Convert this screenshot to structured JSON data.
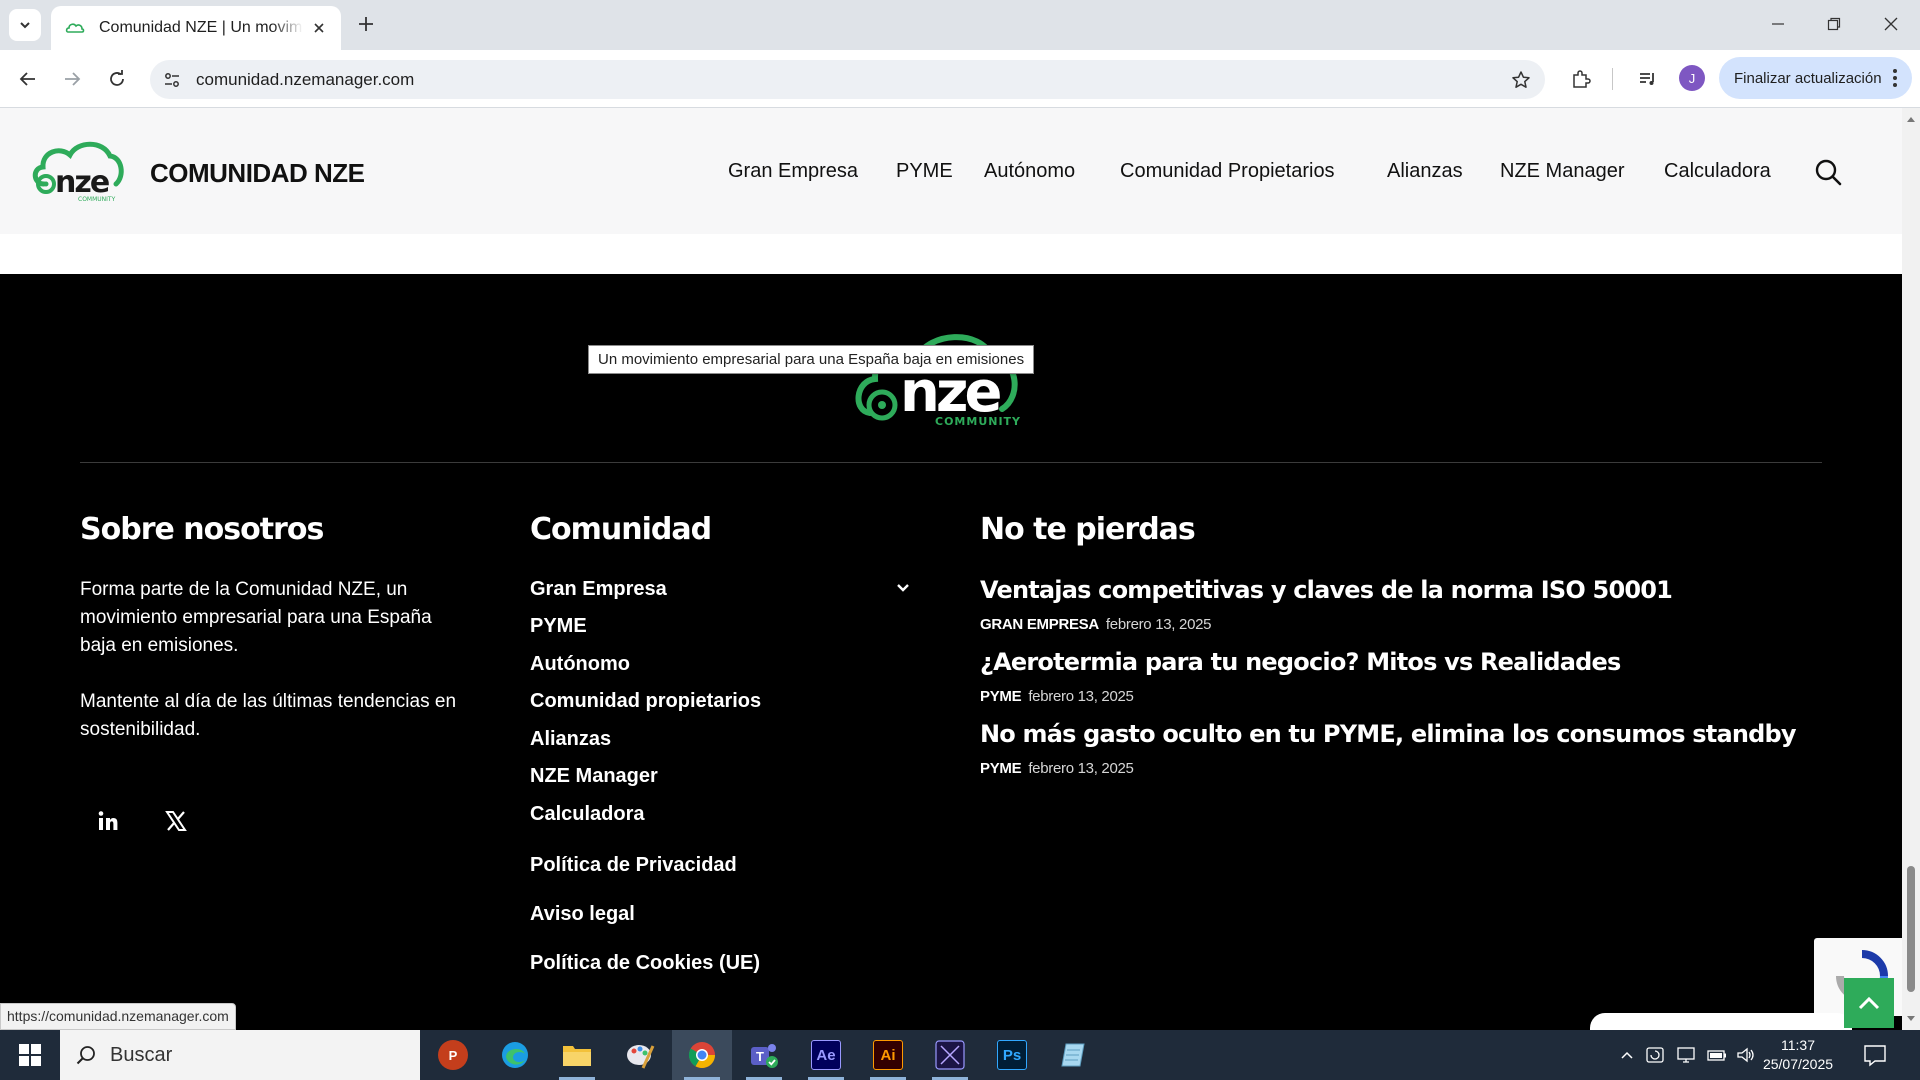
{
  "browser": {
    "tab_title": "Comunidad NZE | Un movimiento empresarial para una España baja en emisiones",
    "url": "comunidad.nzemanager.com",
    "update_button": "Finalizar actualización",
    "profile_initial": "J",
    "status_url": "https://comunidad.nzemanager.com"
  },
  "header": {
    "brand": "COMUNIDAD NZE",
    "nav": [
      "Gran Empresa",
      "PYME",
      "Autónomo",
      "Comunidad Propietarios",
      "Alianzas",
      "NZE Manager",
      "Calculadora"
    ]
  },
  "tooltip": "Un movimiento empresarial para una España baja en emisiones",
  "footer": {
    "logo_text": "nze",
    "logo_sub": "COMMUNITY",
    "about": {
      "title": "Sobre nosotros",
      "p1": "Forma parte de la Comunidad NZE, un movimiento empresarial para una España baja en emisiones.",
      "p2": "Mantente al día de las últimas tendencias en sostenibilidad.",
      "social": [
        "linkedin-icon",
        "x-icon"
      ]
    },
    "community": {
      "title": "Comunidad",
      "links": [
        "Gran Empresa",
        "PYME",
        "Autónomo",
        "Comunidad propietarios",
        "Alianzas",
        "NZE Manager",
        "Calculadora"
      ],
      "legal": [
        "Política de Privacidad",
        "Aviso legal",
        "Política de Cookies (UE)"
      ]
    },
    "dont_miss": {
      "title": "No te pierdas",
      "posts": [
        {
          "title": "Ventajas competitivas y claves de la norma ISO 50001",
          "category": "GRAN EMPRESA",
          "date": "febrero 13, 2025"
        },
        {
          "title": "¿Aerotermia para tu negocio? Mitos vs Realidades",
          "category": "PYME",
          "date": "febrero 13, 2025"
        },
        {
          "title": "No más gasto oculto en tu PYME, elimina los consumos standby",
          "category": "PYME",
          "date": "febrero 13, 2025"
        }
      ]
    }
  },
  "taskbar": {
    "search_label": "Buscar",
    "time": "11:37",
    "date": "25/07/2025",
    "apps": [
      "powerpoint-icon",
      "edge-icon",
      "file-explorer-icon",
      "paint-icon",
      "chrome-icon",
      "teams-icon",
      "after-effects-icon",
      "illustrator-icon",
      "premiere-icon",
      "photoshop-icon",
      "notepad-icon"
    ],
    "app_labels": {
      "powerpoint": "P",
      "after_effects": "Ae",
      "illustrator": "Ai",
      "photoshop": "Ps"
    }
  },
  "colors": {
    "brand_green": "#2eab5a",
    "page_background": "#000000",
    "header_background": "#f7f7f8",
    "taskbar": "#1f2b3a"
  }
}
